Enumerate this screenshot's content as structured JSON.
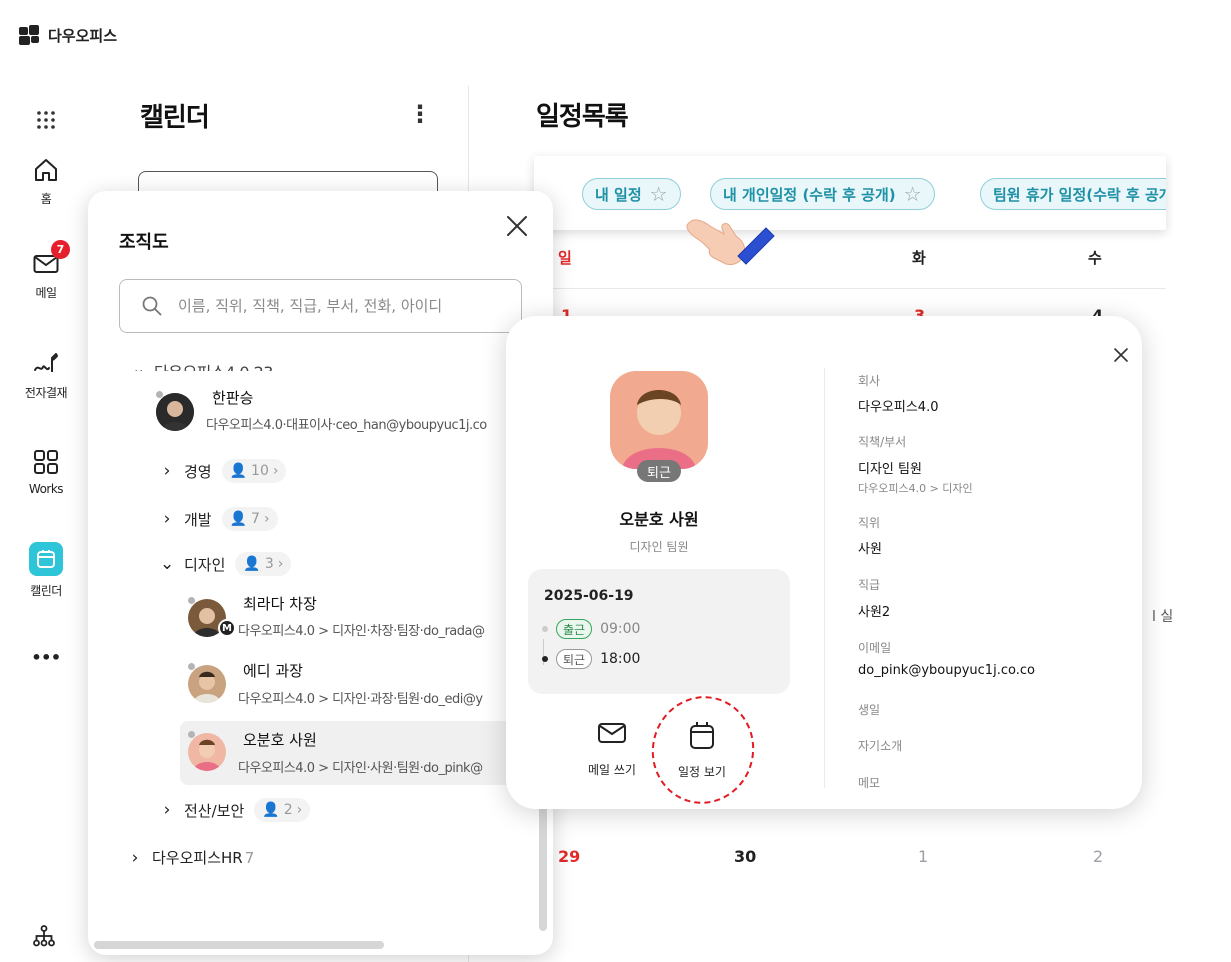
{
  "app": {
    "name": "다우오피스"
  },
  "rail": {
    "items": [
      {
        "label": ""
      },
      {
        "label": "홈"
      },
      {
        "label": "메일",
        "badge": "7"
      },
      {
        "label": "전자결재"
      },
      {
        "label": "Works"
      },
      {
        "label": "캘린더"
      },
      {
        "label": "•••"
      }
    ]
  },
  "calendar_column": {
    "title": "캘린더",
    "menu": "⋮"
  },
  "main": {
    "title": "일정목록",
    "chips": [
      {
        "label": "내 일정"
      },
      {
        "label": "내 개인일정 (수락 후 공개)"
      },
      {
        "label": "팀원 휴가 일정(수락 후 공개)"
      }
    ],
    "weekdays": [
      "일",
      "화",
      "수"
    ],
    "dates_top": [
      "1",
      "3",
      "4"
    ],
    "dates_bottom": [
      "29",
      "30",
      "1",
      "2"
    ],
    "cut_text": "l 실"
  },
  "org": {
    "title": "조직도",
    "search_placeholder": "이름, 직위, 직책, 직급, 부서, 전화, 아이디",
    "root_partial": "다우오피스4.0 23",
    "ceo": {
      "name": "한판승",
      "info": "다우오피스4.0·대표이사·ceo_han@yboupyuc1j.co"
    },
    "depts": [
      {
        "name": "경영",
        "count": "10"
      },
      {
        "name": "개발",
        "count": "7"
      },
      {
        "name": "디자인",
        "count": "3"
      },
      {
        "name": "전산/보안",
        "count": "2"
      }
    ],
    "members": [
      {
        "name": "최라다 차장",
        "info": "다우오피스4.0 > 디자인·차장·팀장·do_rada@",
        "badge": "M"
      },
      {
        "name": "에디 과장",
        "info": "다우오피스4.0 > 디자인·과장·팀원·do_edi@y"
      },
      {
        "name": "오분호 사원",
        "info": "다우오피스4.0 > 디자인·사원·팀원·do_pink@"
      }
    ],
    "hr": {
      "name": "다우오피스HR",
      "count": "7"
    }
  },
  "profile": {
    "status": "퇴근",
    "name": "오분호 사원",
    "dept": "디자인 팀원",
    "attendance": {
      "date": "2025-06-19",
      "in_label": "출근",
      "in_time": "09:00",
      "out_label": "퇴근",
      "out_time": "18:00"
    },
    "actions": {
      "mail": "메일 쓰기",
      "schedule": "일정 보기"
    },
    "fields": {
      "company_label": "회사",
      "company": "다우오피스4.0",
      "position_label": "직책/부서",
      "position": "디자인 팀원",
      "position_path": "다우오피스4.0 > 디자인",
      "rank_label": "직위",
      "rank": "사원",
      "grade_label": "직급",
      "grade": "사원2",
      "email_label": "이메일",
      "email": "do_pink@yboupyuc1j.co.co",
      "birthday_label": "생일",
      "intro_label": "자기소개",
      "memo_label": "메모"
    }
  },
  "colors": {
    "accent": "#2dc5d7",
    "chip_text": "#1f91a6",
    "sunday": "#e32a2a",
    "badge": "#e5202c",
    "highlight": "#e31b23"
  }
}
